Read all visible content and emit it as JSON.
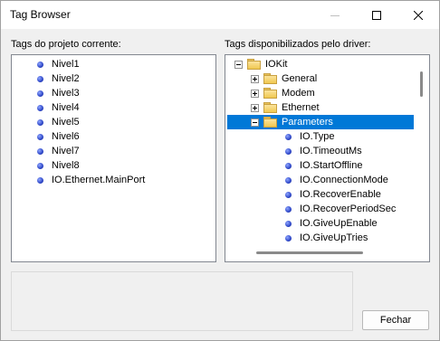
{
  "window": {
    "title": "Tag Browser"
  },
  "left_panel": {
    "label": "Tags do projeto corrente:",
    "items": [
      "Nivel1",
      "Nivel2",
      "Nivel3",
      "Nivel4",
      "Nivel5",
      "Nivel6",
      "Nivel7",
      "Nivel8",
      "IO.Ethernet.MainPort"
    ]
  },
  "right_panel": {
    "label": "Tags disponibilizados pelo driver:",
    "root": "IOKit",
    "folders": [
      "General",
      "Modem",
      "Ethernet",
      "Parameters"
    ],
    "selected": "Parameters",
    "parameters": [
      "IO.Type",
      "IO.TimeoutMs",
      "IO.StartOffline",
      "IO.ConnectionMode",
      "IO.RecoverEnable",
      "IO.RecoverPeriodSec",
      "IO.GiveUpEnable",
      "IO.GiveUpTries"
    ]
  },
  "buttons": {
    "close": "Fechar"
  },
  "colors": {
    "selection": "#0078d7",
    "tag_dot": "#2f48c8",
    "folder": "#f0c850"
  }
}
